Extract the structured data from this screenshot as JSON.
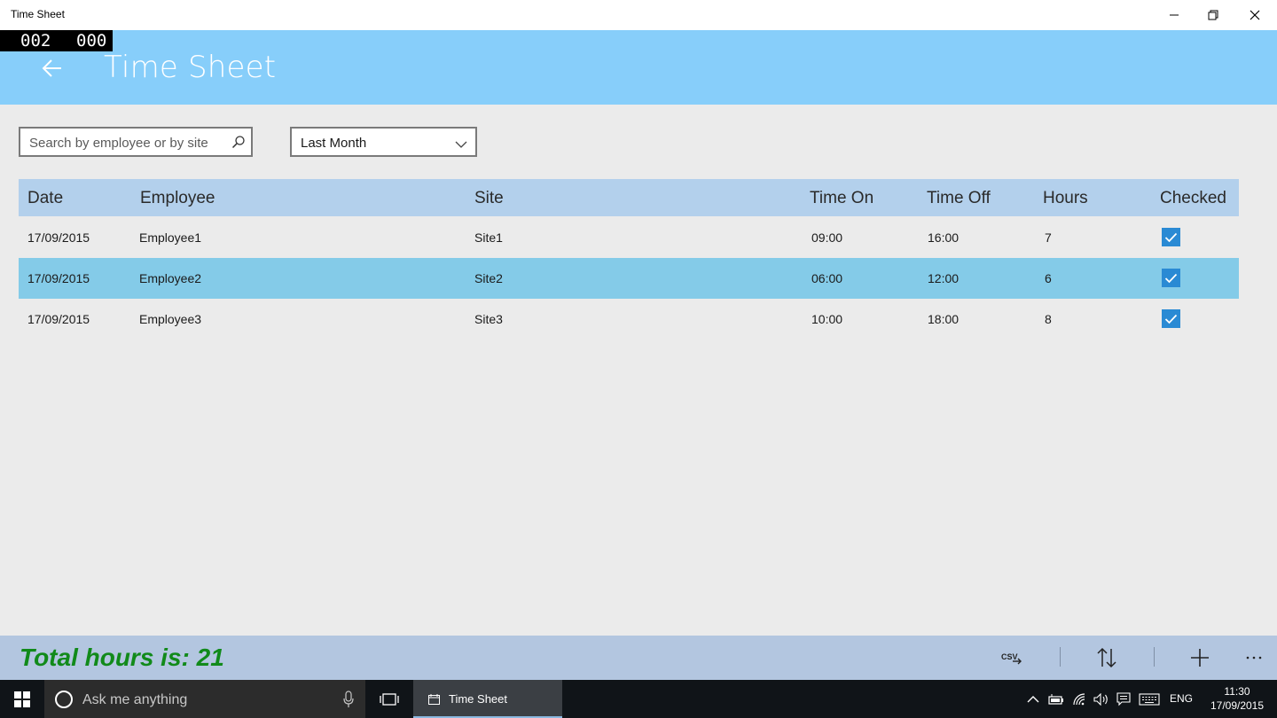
{
  "window": {
    "title": "Time Sheet"
  },
  "counter": {
    "left": "002",
    "right": "000"
  },
  "header": {
    "title": "Time Sheet"
  },
  "search": {
    "placeholder": "Search by employee or by site"
  },
  "period_select": {
    "selected": "Last Month"
  },
  "table": {
    "columns": [
      "Date",
      "Employee",
      "Site",
      "Time On",
      "Time Off",
      "Hours",
      "Checked"
    ],
    "rows": [
      {
        "date": "17/09/2015",
        "employee": "Employee1",
        "site": "Site1",
        "time_on": "09:00",
        "time_off": "16:00",
        "hours": "7",
        "checked": true
      },
      {
        "date": "17/09/2015",
        "employee": "Employee2",
        "site": "Site2",
        "time_on": "06:00",
        "time_off": "12:00",
        "hours": "6",
        "checked": true,
        "selected": true
      },
      {
        "date": "17/09/2015",
        "employee": "Employee3",
        "site": "Site3",
        "time_on": "10:00",
        "time_off": "18:00",
        "hours": "8",
        "checked": true
      }
    ]
  },
  "footer": {
    "total": "Total hours is: 21",
    "csv_label": "CSV"
  },
  "taskbar": {
    "search_placeholder": "Ask me anything",
    "app_label": "Time Sheet",
    "language": "ENG",
    "time": "11:30",
    "date": "17/09/2015"
  },
  "colors": {
    "header_bg": "#87cefa",
    "table_header_bg": "#b3d0ec",
    "selected_row_bg": "#84cbe8",
    "checkbox": "#2a8ad4",
    "total_text": "#118a1a",
    "bottom_bar_bg": "#b3c6e0"
  }
}
